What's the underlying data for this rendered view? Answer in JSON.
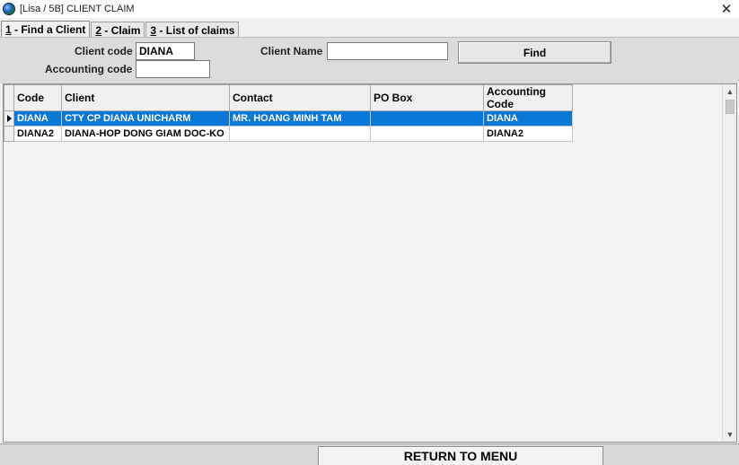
{
  "window": {
    "title": "[Lisa / 5B] CLIENT CLAIM",
    "close_glyph": "✕"
  },
  "tabs": [
    {
      "key": "1",
      "label": " - Find a Client",
      "active": true
    },
    {
      "key": "2",
      "label": " - Claim",
      "active": false
    },
    {
      "key": "3",
      "label": " - List of claims",
      "active": false
    }
  ],
  "search": {
    "client_code_label": "Client code",
    "client_code_value": "DIANA",
    "accounting_code_label": "Accounting code",
    "accounting_code_value": "",
    "client_name_label": "Client Name",
    "client_name_value": "",
    "find_label": "Find"
  },
  "grid": {
    "columns": [
      "Code",
      "Client",
      "Contact",
      "PO Box",
      "Accounting Code"
    ],
    "rows": [
      {
        "code": "DIANA",
        "client": "CTY CP DIANA UNICHARM",
        "contact": "MR. HOANG MINH TAM",
        "po_box": "",
        "accounting_code": "DIANA",
        "selected": true
      },
      {
        "code": "DIANA2",
        "client": "DIANA-HOP DONG GIAM DOC-KO",
        "contact": "",
        "po_box": "",
        "accounting_code": "DIANA2",
        "selected": false
      }
    ],
    "selection_color": "#0a78d7"
  },
  "footer": {
    "return_label": "RETURN TO MENU"
  },
  "icons": {
    "app": "globe-icon",
    "close": "close-icon",
    "row_pointer": "row-pointer-icon",
    "scroll_up": "▲",
    "scroll_down": "▼"
  }
}
